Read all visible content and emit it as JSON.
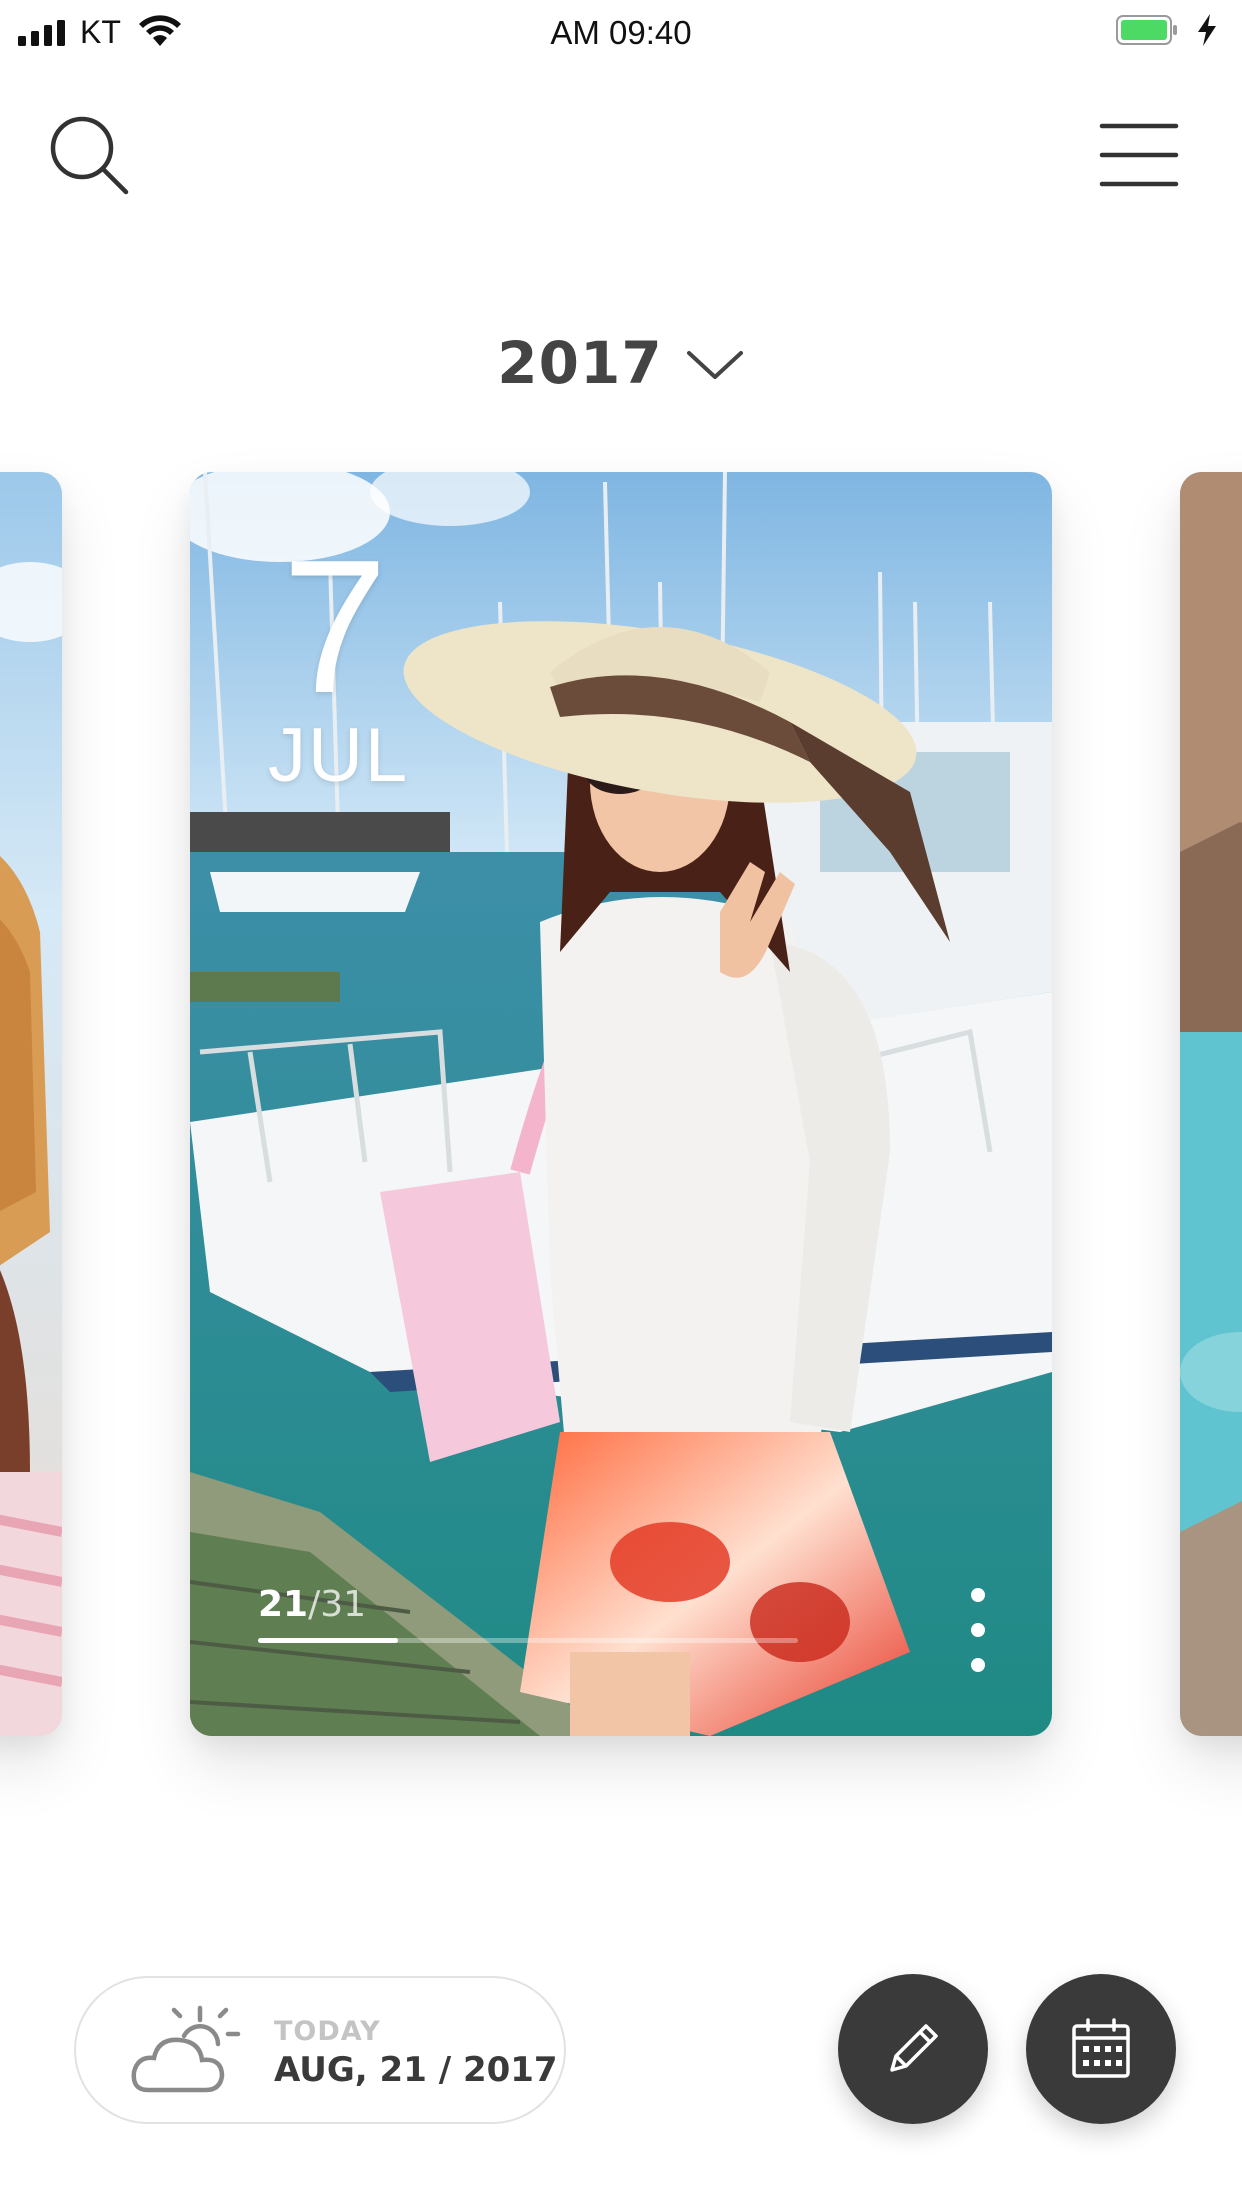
{
  "status_bar": {
    "carrier": "KT",
    "time": "AM 09:40"
  },
  "icons": {
    "search": "search-icon",
    "menu": "hamburger-menu-icon",
    "chevron": "chevron-down-icon",
    "more": "more-vertical-icon",
    "weather": "partly-cloudy-icon",
    "edit": "pencil-icon",
    "calendar": "calendar-icon"
  },
  "year_selector": {
    "year": "2017"
  },
  "current_card": {
    "day": "7",
    "month": "JUL",
    "counter_current": "21",
    "counter_separator": "/",
    "counter_total": "31",
    "progress": 0.26
  },
  "today": {
    "label": "TODAY",
    "date": "AUG, 21 / 2017"
  },
  "colors": {
    "fab_background": "#3a3a3a",
    "battery_green": "#4cd964",
    "year_text": "#444444",
    "today_label": "#c4c4c4"
  }
}
